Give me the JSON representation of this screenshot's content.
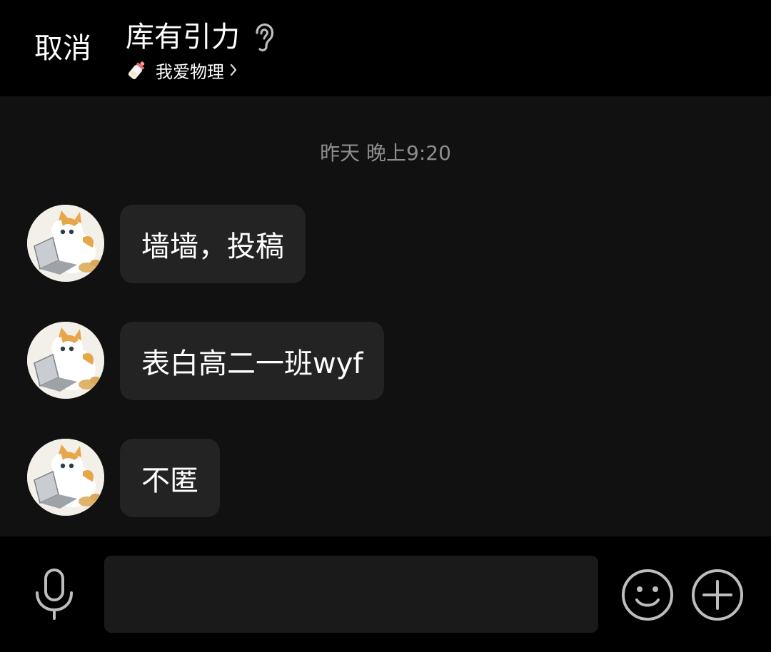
{
  "header": {
    "cancel_label": "取消",
    "title": "库有引力",
    "subtitle": "我爱物理",
    "ear_icon": "ear-icon",
    "bottle_icon": "baby-bottle-icon",
    "chevron_icon": "chevron-right-icon"
  },
  "chat": {
    "timestamp": "昨天 晚上9:20",
    "messages": [
      {
        "text": "墙墙，投稿",
        "avatar": "cat-with-laptop-avatar"
      },
      {
        "text": "表白高二一班wyf",
        "avatar": "cat-with-laptop-avatar"
      },
      {
        "text": "不匿",
        "avatar": "cat-with-laptop-avatar"
      }
    ]
  },
  "input": {
    "value": "",
    "mic_icon": "microphone-icon",
    "emoji_icon": "smiley-icon",
    "plus_icon": "plus-circle-icon"
  },
  "colors": {
    "background": "#000000",
    "chat_background": "#111111",
    "bubble": "#232323",
    "timestamp": "#8e8e8e",
    "icon_gray": "#bdbdbd"
  }
}
